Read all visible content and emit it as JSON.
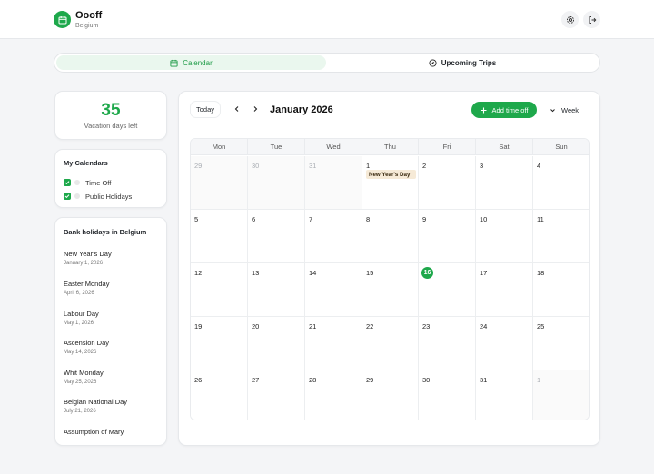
{
  "header": {
    "app_name": "Oooff",
    "location": "Belgium",
    "settings_icon": "gear-icon",
    "logout_icon": "logout-icon"
  },
  "tabs": [
    {
      "label": "Calendar",
      "icon": "calendar-icon",
      "active": true
    },
    {
      "label": "Upcoming Trips",
      "icon": "compass-icon",
      "active": false
    }
  ],
  "vacation": {
    "days_left": "35",
    "label": "Vacation days left"
  },
  "my_calendars": {
    "title": "My Calendars",
    "items": [
      {
        "label": "Time Off",
        "checked": true
      },
      {
        "label": "Public Holidays",
        "checked": true
      }
    ]
  },
  "bank_holidays": {
    "title": "Bank holidays in Belgium",
    "items": [
      {
        "name": "New Year's Day",
        "date": "January 1, 2026"
      },
      {
        "name": "Easter Monday",
        "date": "April 6, 2026"
      },
      {
        "name": "Labour Day",
        "date": "May 1, 2026"
      },
      {
        "name": "Ascension Day",
        "date": "May 14, 2026"
      },
      {
        "name": "Whit Monday",
        "date": "May 25, 2026"
      },
      {
        "name": "Belgian National Day",
        "date": "July 21, 2026"
      },
      {
        "name": "Assumption of Mary",
        "date": ""
      }
    ]
  },
  "calendar": {
    "today_label": "Today",
    "month_label": "January 2026",
    "add_label": "Add time off",
    "view_label": "Week",
    "weekdays": [
      "Mon",
      "Tue",
      "Wed",
      "Thu",
      "Fri",
      "Sat",
      "Sun"
    ],
    "weeks": [
      [
        {
          "d": "29",
          "other": true
        },
        {
          "d": "30",
          "other": true
        },
        {
          "d": "31",
          "other": true
        },
        {
          "d": "1",
          "event": "New Year's Day"
        },
        {
          "d": "2"
        },
        {
          "d": "3"
        },
        {
          "d": "4"
        }
      ],
      [
        {
          "d": "5"
        },
        {
          "d": "6"
        },
        {
          "d": "7"
        },
        {
          "d": "8"
        },
        {
          "d": "9"
        },
        {
          "d": "10"
        },
        {
          "d": "11"
        }
      ],
      [
        {
          "d": "12"
        },
        {
          "d": "13"
        },
        {
          "d": "14"
        },
        {
          "d": "15"
        },
        {
          "d": "16",
          "today": true
        },
        {
          "d": "17"
        },
        {
          "d": "18"
        }
      ],
      [
        {
          "d": "19"
        },
        {
          "d": "20"
        },
        {
          "d": "21"
        },
        {
          "d": "22"
        },
        {
          "d": "23"
        },
        {
          "d": "24"
        },
        {
          "d": "25"
        }
      ],
      [
        {
          "d": "26"
        },
        {
          "d": "27"
        },
        {
          "d": "28"
        },
        {
          "d": "29"
        },
        {
          "d": "30"
        },
        {
          "d": "31"
        },
        {
          "d": "1",
          "other": true
        }
      ]
    ]
  },
  "colors": {
    "accent": "#1ea84b",
    "event_bg": "#f6ead7",
    "active_tab_bg": "#eaf7ee"
  }
}
